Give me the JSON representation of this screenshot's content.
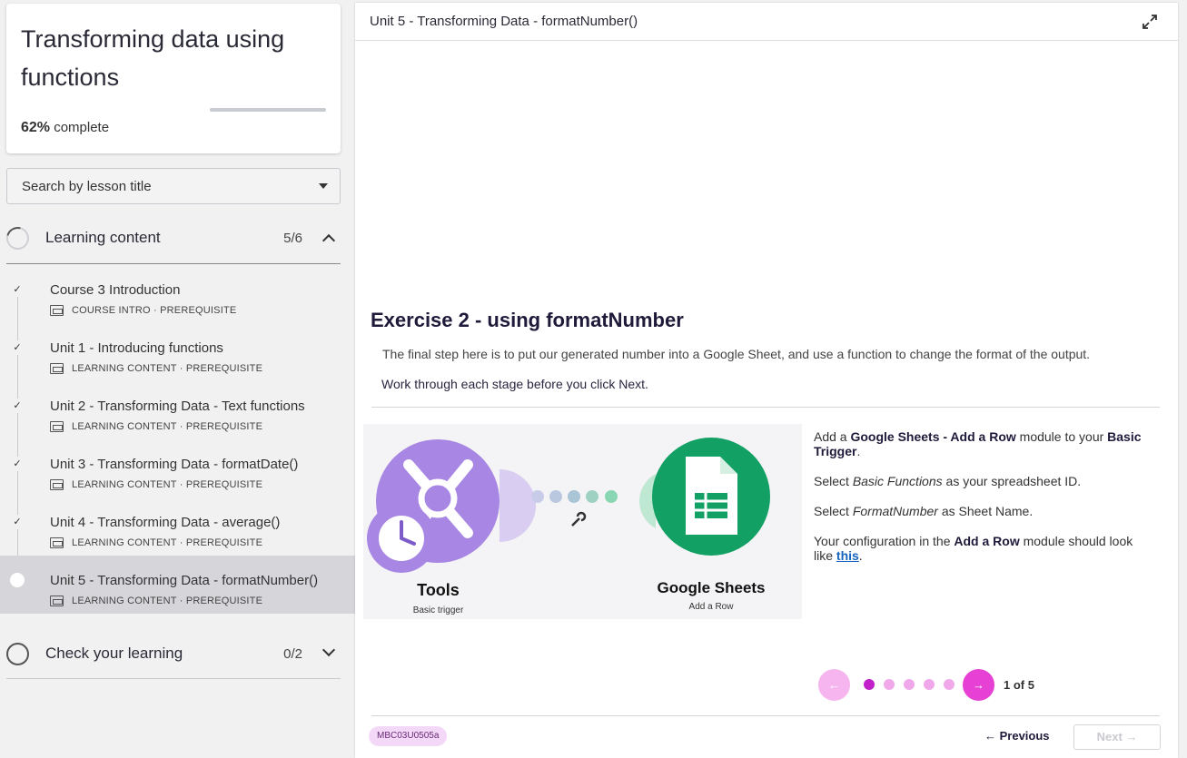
{
  "sidebar": {
    "course_title": "Transforming data using functions",
    "progress": {
      "percent_label": "62%",
      "suffix": " complete",
      "fraction": 0.62
    },
    "search_label": "Search by lesson title",
    "sections": [
      {
        "label": "Learning content",
        "count": "5/6"
      },
      {
        "label": "Check your learning",
        "count": "0/2"
      }
    ],
    "lessons": [
      {
        "title": "Course 3 Introduction",
        "meta": "COURSE INTRO · PREREQUISITE",
        "done": true
      },
      {
        "title": "Unit 1 - Introducing functions",
        "meta": "LEARNING CONTENT · PREREQUISITE",
        "done": true
      },
      {
        "title": "Unit 2 - Transforming Data - Text functions",
        "meta": "LEARNING CONTENT · PREREQUISITE",
        "done": true
      },
      {
        "title": "Unit 3 - Transforming Data - formatDate()",
        "meta": "LEARNING CONTENT · PREREQUISITE",
        "done": true
      },
      {
        "title": "Unit 4 - Transforming Data - average()",
        "meta": "LEARNING CONTENT · PREREQUISITE",
        "done": true
      },
      {
        "title": "Unit 5 - Transforming Data - formatNumber()",
        "meta": "LEARNING CONTENT · PREREQUISITE",
        "done": false
      }
    ]
  },
  "main": {
    "header_title": "Unit 5 - Transforming Data - formatNumber()",
    "exercise_title": "Exercise 2 - using formatNumber",
    "description": "The final step here is to put our generated number into a Google Sheet, and use a function to change the format of the output.",
    "note": "Work through each stage before you click Next.",
    "illustration": {
      "left_title": "Tools",
      "left_sub": "Basic trigger",
      "right_title": "Google Sheets",
      "right_sub": "Add a Row"
    },
    "instructions": {
      "p1_a": "Add a ",
      "p1_b": "Google Sheets - Add a Row",
      "p1_c": " module to your ",
      "p1_d": "Basic Trigger",
      "p1_e": ".",
      "p2_a": "Select ",
      "p2_b": "Basic Functions",
      "p2_c": " as your spreadsheet ID.",
      "p3_a": "Select ",
      "p3_b": "FormatNumber",
      "p3_c": " as Sheet Name.",
      "p4_a": "Your configuration in the ",
      "p4_b": "Add a Row",
      "p4_c": " module should look like ",
      "p4_link": "this",
      "p4_d": "."
    },
    "pager": {
      "count": "1 of 5"
    },
    "footer": {
      "badge": "MBC03U0505a",
      "previous": "← Previous",
      "next": "Next →"
    }
  }
}
